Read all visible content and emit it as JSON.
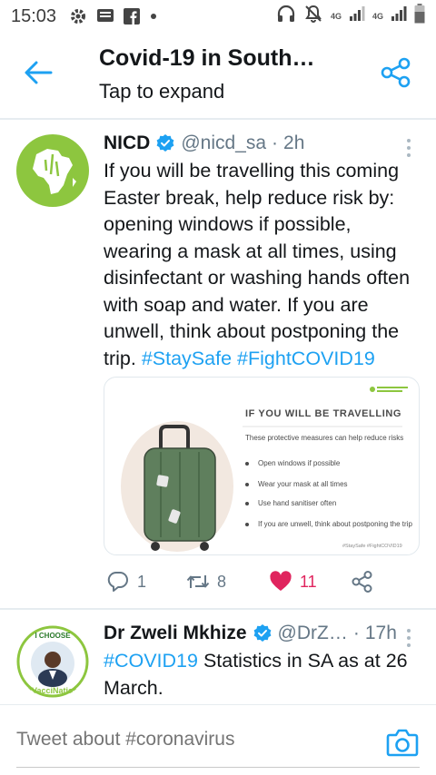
{
  "status_bar": {
    "time": "15:03",
    "network_a": "4G",
    "network_b": "4G",
    "icons": [
      "settings-icon",
      "message-icon",
      "facebook-icon",
      "dot-icon",
      "headset-icon",
      "mute-icon",
      "signal-icon",
      "battery-icon"
    ]
  },
  "header": {
    "title": "Covid-19 in South…",
    "subtitle": "Tap to expand",
    "accent": "#1da1f2"
  },
  "tweets": [
    {
      "name": "NICD",
      "handle": "@nicd_sa",
      "separator": "·",
      "time": "2h",
      "body_text": "If you will be travelling this coming Easter break, help reduce risk by: opening windows if possible, wearing a mask at all times, using disinfectant or washing hands often with soap and water. If you are unwell, think about postponing the trip.",
      "hashtag_1": "#StaySafe",
      "hashtag_2": "#FightCOVID19",
      "media": {
        "title": "IF YOU WILL BE TRAVELLING",
        "subtitle": "These protective measures can help reduce risks",
        "items": [
          "Open windows if possible",
          "Wear your mask at all times",
          "Use hand sanitiser often",
          "If you are unwell, think about postponing the trip"
        ],
        "footer": "#StaySafe #FightCOVID19"
      },
      "replies": "1",
      "retweets": "8",
      "likes": "11",
      "liked": true
    },
    {
      "name": "Dr Zweli Mkhize",
      "handle": "@DrZ…",
      "separator": "·",
      "time": "17h",
      "hashtag": "#COVID19",
      "body_text": " Statistics in SA as at 26 March.",
      "avatar_top_text": "I CHOOSE",
      "avatar_bottom_text": "#VacciNation"
    }
  ],
  "compose": {
    "placeholder": "Tweet about #coronavirus"
  },
  "colors": {
    "twitter_blue": "#1da1f2",
    "like_red": "#e0245e",
    "muted_gray": "#657786",
    "nicd_green": "#8dc63f"
  }
}
